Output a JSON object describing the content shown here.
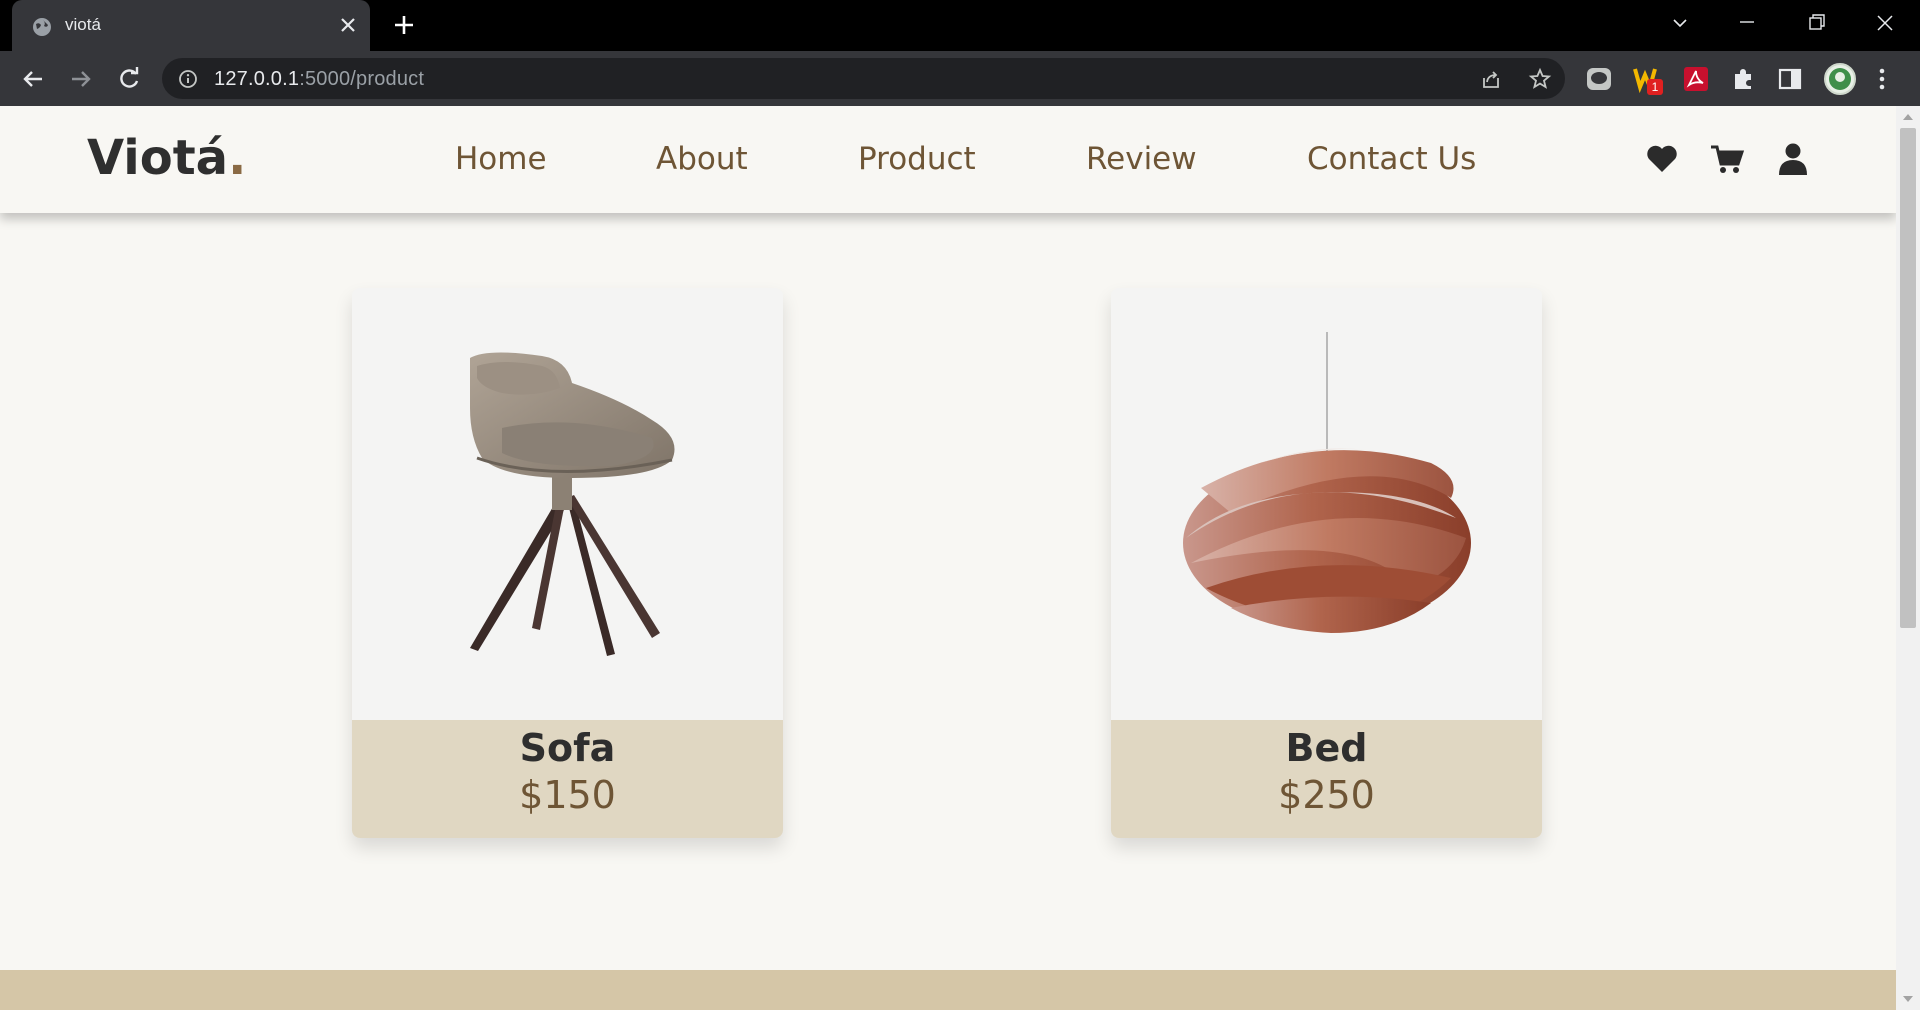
{
  "browser": {
    "tab_title": "viotá",
    "url_host": "127.0.0.1",
    "url_rest": ":5000/product",
    "extension_badge": "1"
  },
  "site": {
    "logo_text": "Viotá",
    "logo_dot": ".",
    "nav": [
      {
        "label": "Home"
      },
      {
        "label": "About"
      },
      {
        "label": "Product"
      },
      {
        "label": "Review"
      },
      {
        "label": "Contact Us"
      }
    ],
    "header_icons": [
      "heart-icon",
      "cart-icon",
      "user-icon"
    ]
  },
  "products": [
    {
      "name": "Sofa",
      "price": "$150",
      "image": "chair"
    },
    {
      "name": "Bed",
      "price": "$250",
      "image": "pendant-lamp"
    }
  ],
  "colors": {
    "accent": "#6e5535",
    "card_info_bg": "#e0d7c2",
    "footer_band": "#d5c6a7",
    "page_bg": "#f8f7f3"
  }
}
